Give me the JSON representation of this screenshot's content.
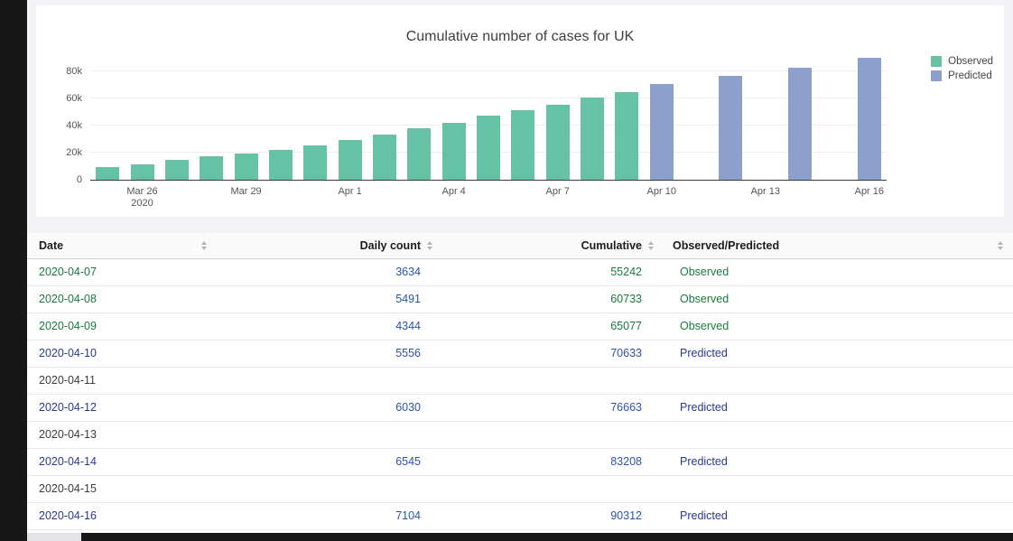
{
  "app": {
    "background": "#f2f2f7",
    "desktop_color": "#171717"
  },
  "chart": {
    "title": "Cumulative number of cases for UK",
    "legend": [
      {
        "label": "Observed",
        "color": "#66c2a5"
      },
      {
        "label": "Predicted",
        "color": "#8da0cb"
      }
    ],
    "chart_data": {
      "type": "bar",
      "title": "Cumulative number of cases for UK",
      "xlabel": "",
      "ylabel": "",
      "ylim": [
        0,
        95000
      ],
      "grid": true,
      "legend_position": "top-right",
      "x": [
        "2020-03-25",
        "2020-03-26",
        "2020-03-27",
        "2020-03-28",
        "2020-03-29",
        "2020-03-30",
        "2020-03-31",
        "2020-04-01",
        "2020-04-02",
        "2020-04-03",
        "2020-04-04",
        "2020-04-05",
        "2020-04-06",
        "2020-04-07",
        "2020-04-08",
        "2020-04-09",
        "2020-04-10",
        "2020-04-11",
        "2020-04-12",
        "2020-04-13",
        "2020-04-14",
        "2020-04-15",
        "2020-04-16"
      ],
      "series": [
        {
          "name": "Observed",
          "color": "#66c2a5",
          "values": [
            9529,
            11658,
            14543,
            17089,
            19522,
            22141,
            25150,
            29474,
            33718,
            38168,
            41903,
            47806,
            51608,
            55242,
            60733,
            65077,
            null,
            null,
            null,
            null,
            null,
            null,
            null
          ]
        },
        {
          "name": "Predicted",
          "color": "#8da0cb",
          "values": [
            null,
            null,
            null,
            null,
            null,
            null,
            null,
            null,
            null,
            null,
            null,
            null,
            null,
            null,
            null,
            null,
            70633,
            null,
            76663,
            null,
            83208,
            null,
            90312
          ]
        }
      ],
      "yticks": [
        {
          "v": 0,
          "label": "0"
        },
        {
          "v": 20000,
          "label": "20k"
        },
        {
          "v": 40000,
          "label": "40k"
        },
        {
          "v": 60000,
          "label": "60k"
        },
        {
          "v": 80000,
          "label": "80k"
        }
      ],
      "xticks": [
        {
          "i": 1,
          "label": "Mar 26",
          "sub": "2020"
        },
        {
          "i": 4,
          "label": "Mar 29"
        },
        {
          "i": 7,
          "label": "Apr 1"
        },
        {
          "i": 10,
          "label": "Apr 4"
        },
        {
          "i": 13,
          "label": "Apr 7"
        },
        {
          "i": 16,
          "label": "Apr 10"
        },
        {
          "i": 19,
          "label": "Apr 13"
        },
        {
          "i": 22,
          "label": "Apr 16"
        }
      ]
    }
  },
  "table": {
    "columns": [
      {
        "label": "Date",
        "align": "left"
      },
      {
        "label": "Daily count",
        "align": "right"
      },
      {
        "label": "Cumulative",
        "align": "right"
      },
      {
        "label": "Observed/Predicted",
        "align": "left"
      }
    ],
    "cell_colors": {
      "Observed": {
        "date": "#1b7a3d",
        "daily": "#2a52b0",
        "cumulative": "#1b7a3d",
        "status": "#1b7a3d"
      },
      "Predicted": {
        "date": "#2a3990",
        "daily": "#2a52b0",
        "cumulative": "#2a52b0",
        "status": "#2a3990"
      },
      "none": {
        "date": "#3c3c3c",
        "daily": "#3c3c3c",
        "cumulative": "#3c3c3c",
        "status": "#3c3c3c"
      }
    },
    "rows": [
      {
        "date": "2020-04-07",
        "daily": "3634",
        "cumulative": "55242",
        "status": "Observed"
      },
      {
        "date": "2020-04-08",
        "daily": "5491",
        "cumulative": "60733",
        "status": "Observed"
      },
      {
        "date": "2020-04-09",
        "daily": "4344",
        "cumulative": "65077",
        "status": "Observed"
      },
      {
        "date": "2020-04-10",
        "daily": "5556",
        "cumulative": "70633",
        "status": "Predicted"
      },
      {
        "date": "2020-04-11",
        "daily": "",
        "cumulative": "",
        "status": ""
      },
      {
        "date": "2020-04-12",
        "daily": "6030",
        "cumulative": "76663",
        "status": "Predicted"
      },
      {
        "date": "2020-04-13",
        "daily": "",
        "cumulative": "",
        "status": ""
      },
      {
        "date": "2020-04-14",
        "daily": "6545",
        "cumulative": "83208",
        "status": "Predicted"
      },
      {
        "date": "2020-04-15",
        "daily": "",
        "cumulative": "",
        "status": ""
      },
      {
        "date": "2020-04-16",
        "daily": "7104",
        "cumulative": "90312",
        "status": "Predicted"
      }
    ]
  }
}
